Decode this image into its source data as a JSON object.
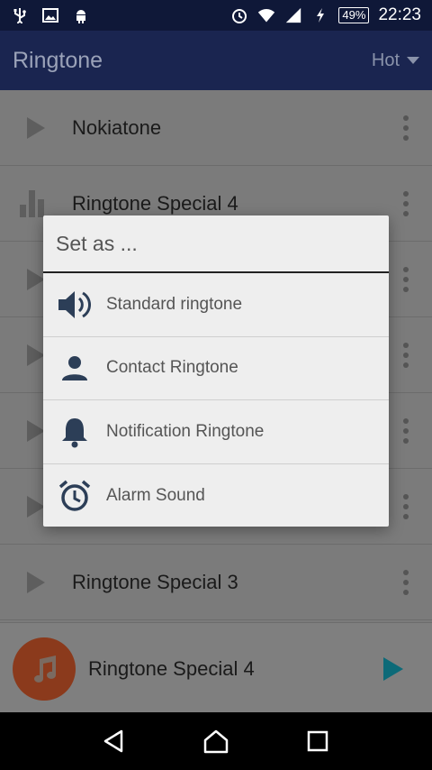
{
  "status_bar": {
    "battery": "49%",
    "time": "22:23"
  },
  "app_bar": {
    "title": "Ringtone",
    "filter": "Hot"
  },
  "list": {
    "items": [
      {
        "title": "Nokiatone"
      },
      {
        "title": "Ringtone Special 4"
      },
      {
        "title": ""
      },
      {
        "title": ""
      },
      {
        "title": ""
      },
      {
        "title": ""
      },
      {
        "title": "Ringtone Special 3"
      }
    ]
  },
  "player": {
    "title": "Ringtone Special 4"
  },
  "dialog": {
    "title": "Set as ...",
    "options": [
      {
        "label": "Standard ringtone",
        "icon": "speaker-icon"
      },
      {
        "label": "Contact Ringtone",
        "icon": "person-icon"
      },
      {
        "label": "Notification Ringtone",
        "icon": "bell-icon"
      },
      {
        "label": "Alarm Sound",
        "icon": "alarm-clock-icon"
      }
    ]
  },
  "colors": {
    "dialog_icon": "#2c3e57",
    "app_bar": "#1a2550",
    "player_accent": "#0d6a78",
    "avatar": "#8b3a1c"
  }
}
